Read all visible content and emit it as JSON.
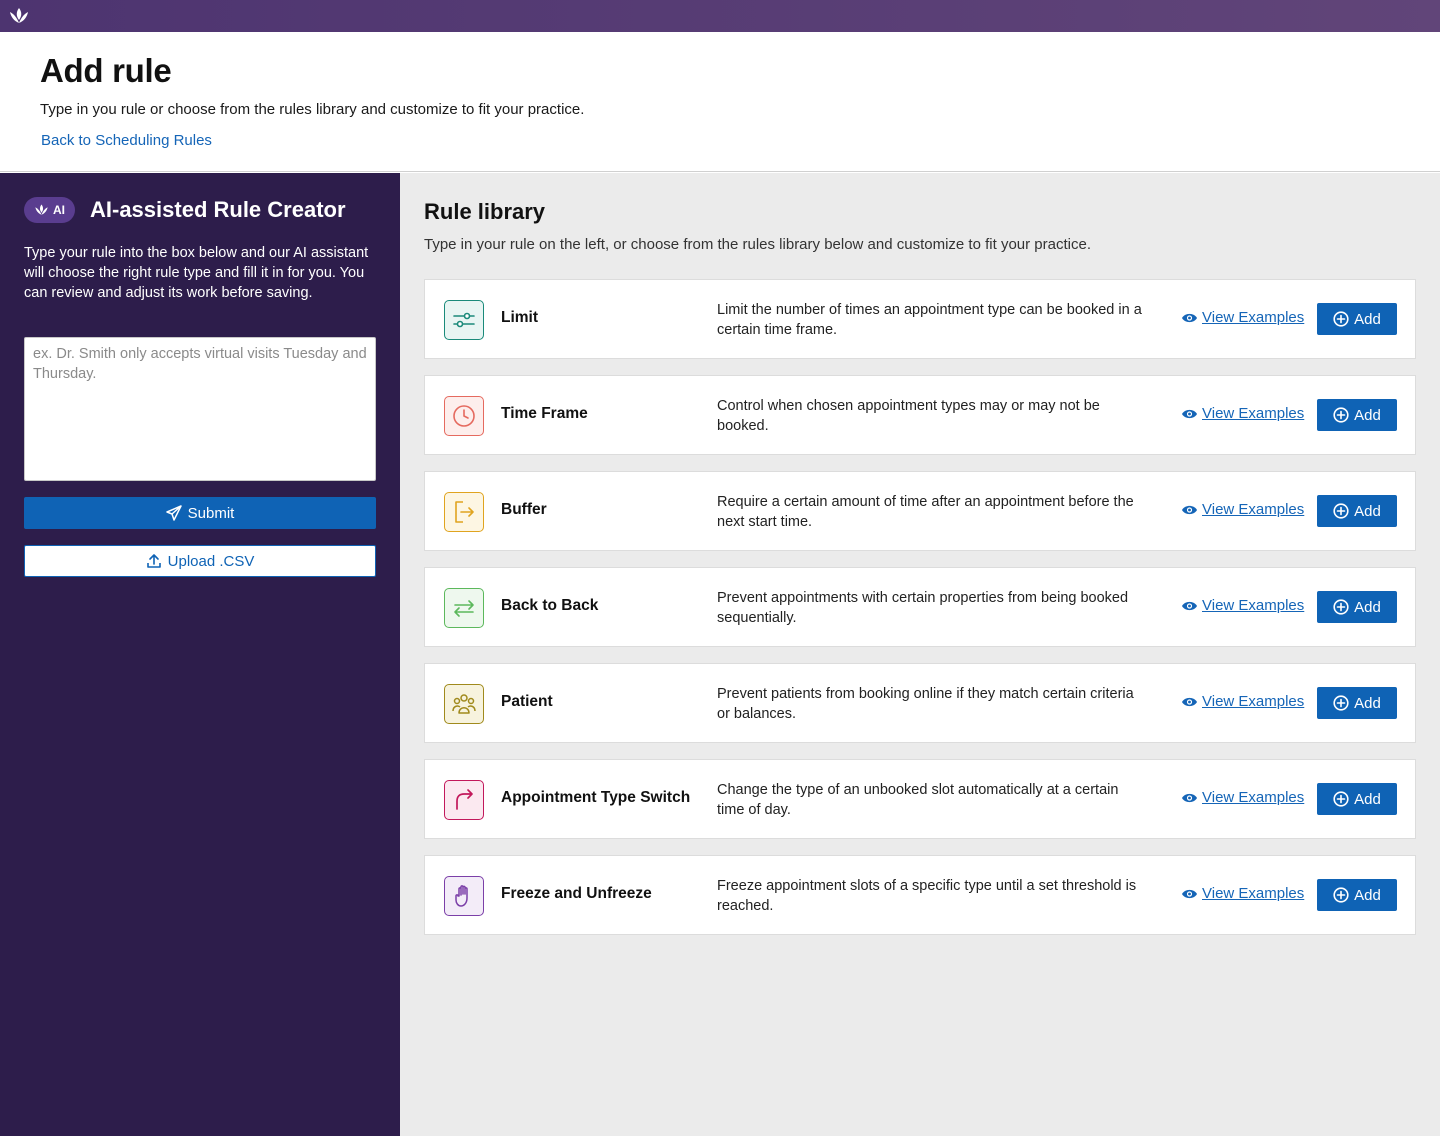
{
  "topbar": {
    "logo_icon": "lotus-logo-icon"
  },
  "header": {
    "title": "Add rule",
    "subtitle": "Type in you rule or choose from the rules library and customize to fit your practice.",
    "back_link": "Back to Scheduling Rules"
  },
  "ai_panel": {
    "badge": "AI",
    "title": "AI-assisted Rule Creator",
    "description": "Type your rule into the box below and our AI assistant will choose the right rule type and fill it in for you. You can review and adjust its work before saving.",
    "input_placeholder": "ex. Dr. Smith only accepts virtual visits Tuesday and Thursday.",
    "input_value": "",
    "submit_label": "Submit",
    "upload_label": "Upload .CSV"
  },
  "library": {
    "title": "Rule library",
    "description": "Type in your rule on the left, or choose from the rules library below and customize to fit your practice.",
    "view_label": "View Examples",
    "add_label": "Add",
    "rules": [
      {
        "title": "Limit",
        "description": "Limit the number of times an appointment type can be booked in a certain time frame.",
        "icon": "sliders-icon",
        "color": "#1a8a7a",
        "bg": "#e8f5f3"
      },
      {
        "title": "Time Frame",
        "description": "Control when chosen appointment types may or may not be booked.",
        "icon": "clock-icon",
        "color": "#e56a5f",
        "bg": "#fdeeec"
      },
      {
        "title": "Buffer",
        "description": "Require a certain amount of time after an appointment before the next start time.",
        "icon": "exit-icon",
        "color": "#e0a41f",
        "bg": "#fdf6e3"
      },
      {
        "title": "Back to Back",
        "description": "Prevent appointments with certain properties from being booked sequentially.",
        "icon": "swap-arrows-icon",
        "color": "#5cb85c",
        "bg": "#eef8ee"
      },
      {
        "title": "Patient",
        "description": "Prevent patients from booking online if they match certain criteria or balances.",
        "icon": "people-icon",
        "color": "#a08a1c",
        "bg": "#f7f3de"
      },
      {
        "title": "Appointment Type Switch",
        "description": "Change the type of an unbooked slot automatically at a certain time of day.",
        "icon": "redirect-arrow-icon",
        "color": "#c2185b",
        "bg": "#fbe9f0"
      },
      {
        "title": "Freeze and Unfreeze",
        "description": "Freeze appointment slots of a specific type until a set threshold is reached.",
        "icon": "hand-icon",
        "color": "#7b3fa8",
        "bg": "#f3ecf8"
      }
    ]
  }
}
